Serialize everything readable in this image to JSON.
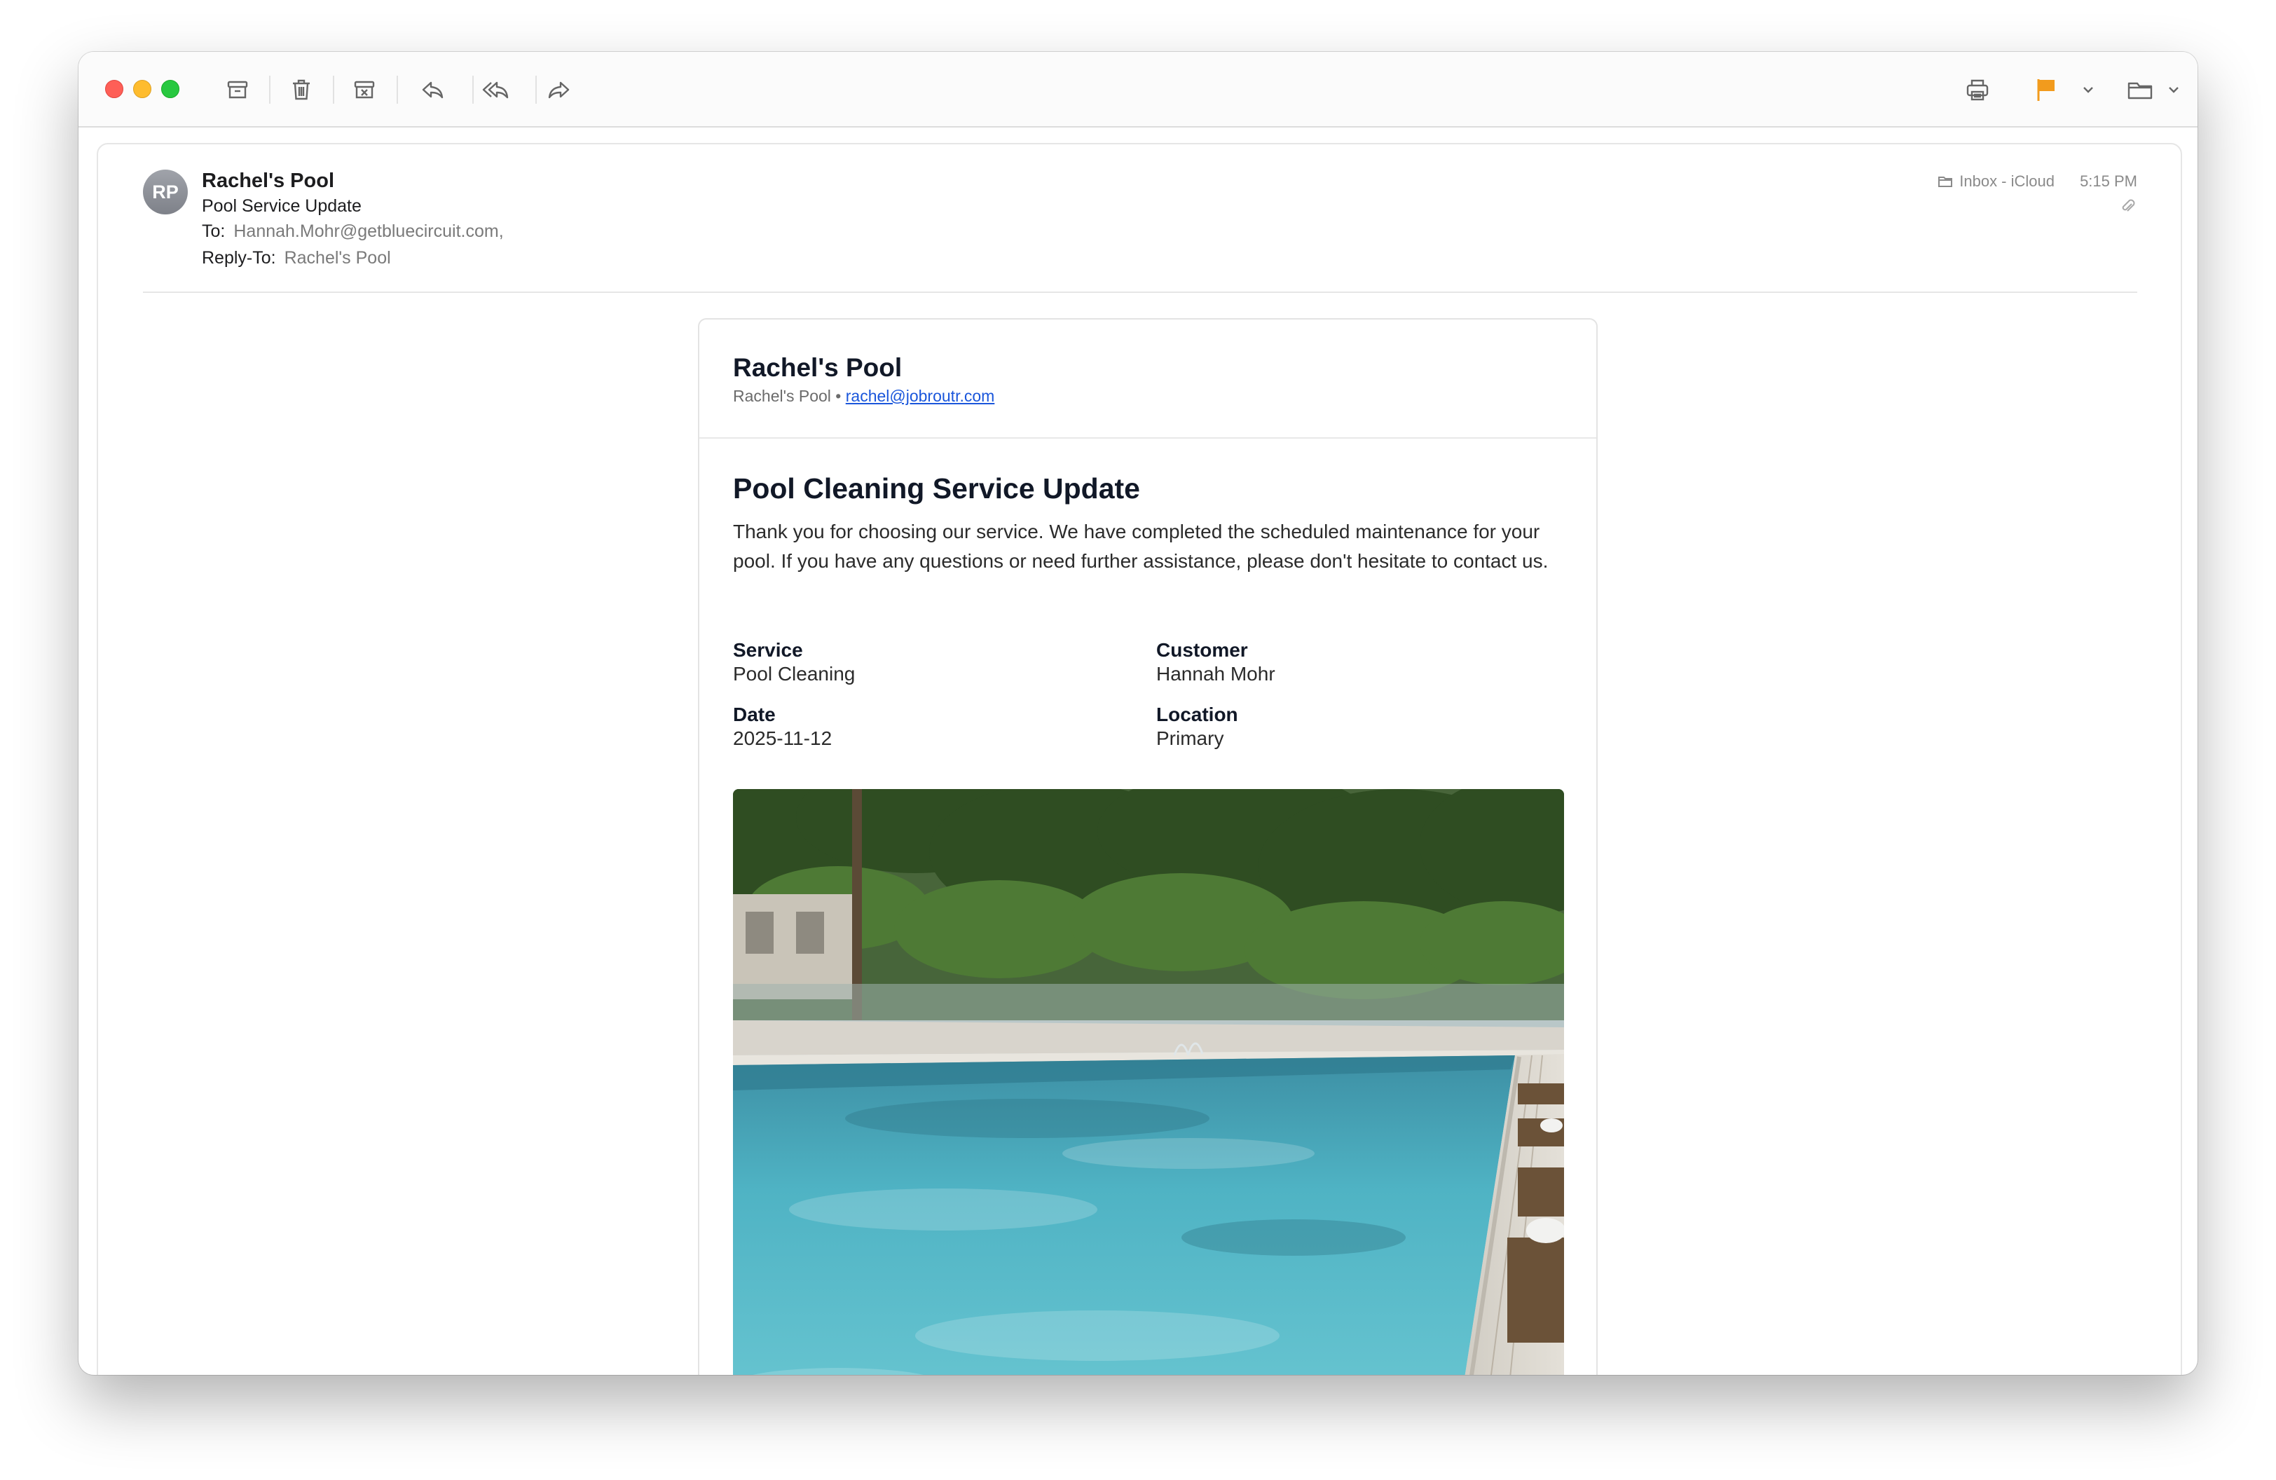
{
  "toolbar": {
    "icons": [
      "archive-icon",
      "trash-icon",
      "junk-icon",
      "reply-icon",
      "reply-all-icon",
      "forward-icon",
      "print-icon",
      "flag-icon",
      "chevron-down-icon",
      "folder-icon",
      "chevron-down-icon"
    ],
    "flag_color": "#f29b1d"
  },
  "email": {
    "avatar_initials": "RP",
    "sender": "Rachel's Pool",
    "subject": "Pool Service Update",
    "to_label": "To:",
    "to_value": "Hannah.Mohr@getbluecircuit.com,",
    "reply_to_label": "Reply-To:",
    "reply_to_value": "Rachel's Pool",
    "mailbox": "Inbox - iCloud",
    "time": "5:15 PM"
  },
  "message": {
    "brand_title": "Rachel's Pool",
    "brand_sub": "Rachel's Pool •",
    "brand_email": "rachel@jobroutr.com",
    "headline": "Pool Cleaning Service Update",
    "intro": "Thank you for choosing our service. We have completed the scheduled maintenance for your pool. If you have any questions or need further assistance, please don't hesitate to contact us.",
    "fields": [
      {
        "label": "Service",
        "value": "Pool Cleaning"
      },
      {
        "label": "Customer",
        "value": "Hannah Mohr"
      },
      {
        "label": "Date",
        "value": "2025-11-12"
      },
      {
        "label": "Location",
        "value": "Primary"
      }
    ],
    "photo_alt": "pool-photo"
  }
}
